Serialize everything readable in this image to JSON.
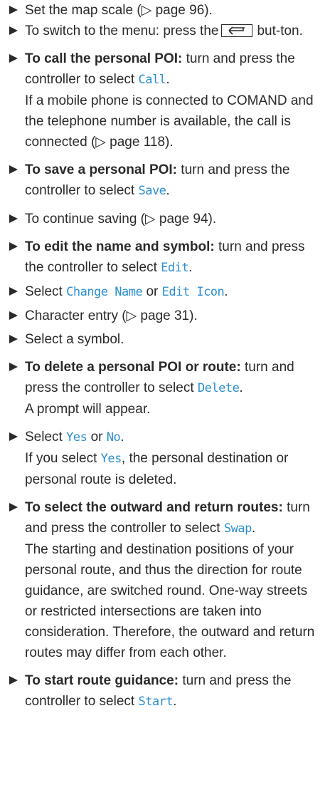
{
  "steps": [
    {
      "text": "Set the map scale (▷ page 96)."
    },
    {
      "prefix": "To switch to the menu: press the",
      "icon": "back-button-icon",
      "suffix": "but-ton."
    },
    {
      "bold": "To call the personal POI:",
      "text": "turn and press the controller to select",
      "option": "Call",
      "tail": ".",
      "desc": "If a mobile phone is connected to COMAND and the telephone number is available, the call is connected (▷ page 118)."
    },
    {
      "bold": "To save a personal POI:",
      "text": "turn and press the controller to select",
      "option": "Save",
      "tail": "."
    },
    {
      "text": "To continue saving (▷ page 94)."
    },
    {
      "bold": "To edit the name and symbol:",
      "text": "turn and press the controller to select",
      "option": "Edit",
      "tail": "."
    },
    {
      "prefix": "Select",
      "option1": "Change Name",
      "mid": "or",
      "option2": "Edit Icon",
      "tail": "."
    },
    {
      "text": "Character entry (▷ page 31)."
    },
    {
      "text": "Select a symbol."
    },
    {
      "bold": "To delete a personal POI or route:",
      "text": "turn and press the controller to select",
      "option": "Delete",
      "tail": ".",
      "desc": "A prompt will appear."
    },
    {
      "prefix": "Select",
      "option1": "Yes",
      "mid": "or",
      "option2": "No",
      "tail": ".",
      "desc_prefix": "If you select",
      "desc_option": "Yes",
      "desc_suffix": ", the personal destination or personal route is deleted."
    },
    {
      "bold": "To select the outward and return routes:",
      "text": "turn and press the controller to select",
      "option": "Swap",
      "tail": ".",
      "desc": "The starting and destination positions of your personal route, and thus the direction for route guidance, are switched round. One-way streets or restricted intersections are taken into consideration. Therefore, the outward and return routes may differ from each other."
    },
    {
      "bold": "To start route guidance:",
      "text": "turn and press the controller to select",
      "option": "Start",
      "tail": "."
    }
  ],
  "colors": {
    "option": "#2b8fd1",
    "text": "#2a2a2a"
  }
}
